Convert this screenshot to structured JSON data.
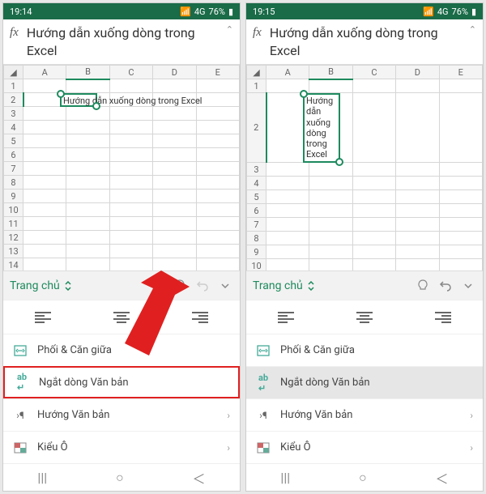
{
  "left": {
    "status": {
      "time": "19:14",
      "signal": "📶",
      "rate": "4G",
      "battery_pct": "76%"
    },
    "formula_text": "Hướng dẫn xuống dòng trong Excel",
    "columns": [
      "A",
      "B",
      "C",
      "D",
      "E"
    ],
    "active_col": "B",
    "active_row": "2",
    "cell_overflow_text": "Hướng dẫn xuống dòng trong Excel",
    "toolbar": {
      "home": "Trang chủ"
    },
    "menu": {
      "merge": "Phối & Căn giữa",
      "wrap": "Ngắt dòng Văn bản",
      "direction": "Hướng Văn bản",
      "cellstyle": "Kiểu Ô"
    }
  },
  "right": {
    "status": {
      "time": "19:15",
      "signal": "📶",
      "rate": "4G",
      "battery_pct": "76%"
    },
    "formula_text": "Hướng dẫn xuống dòng trong Excel",
    "columns": [
      "A",
      "B",
      "C",
      "D",
      "E"
    ],
    "active_col": "B",
    "active_row": "2",
    "cell_wrapped_lines": [
      "Hướng",
      "dẫn",
      "xuống",
      "dòng",
      "trong",
      "Excel"
    ],
    "toolbar": {
      "home": "Trang chủ"
    },
    "menu": {
      "merge": "Phối & Căn giữa",
      "wrap": "Ngắt dòng Văn bản",
      "direction": "Hướng Văn bản",
      "cellstyle": "Kiểu Ô"
    }
  }
}
